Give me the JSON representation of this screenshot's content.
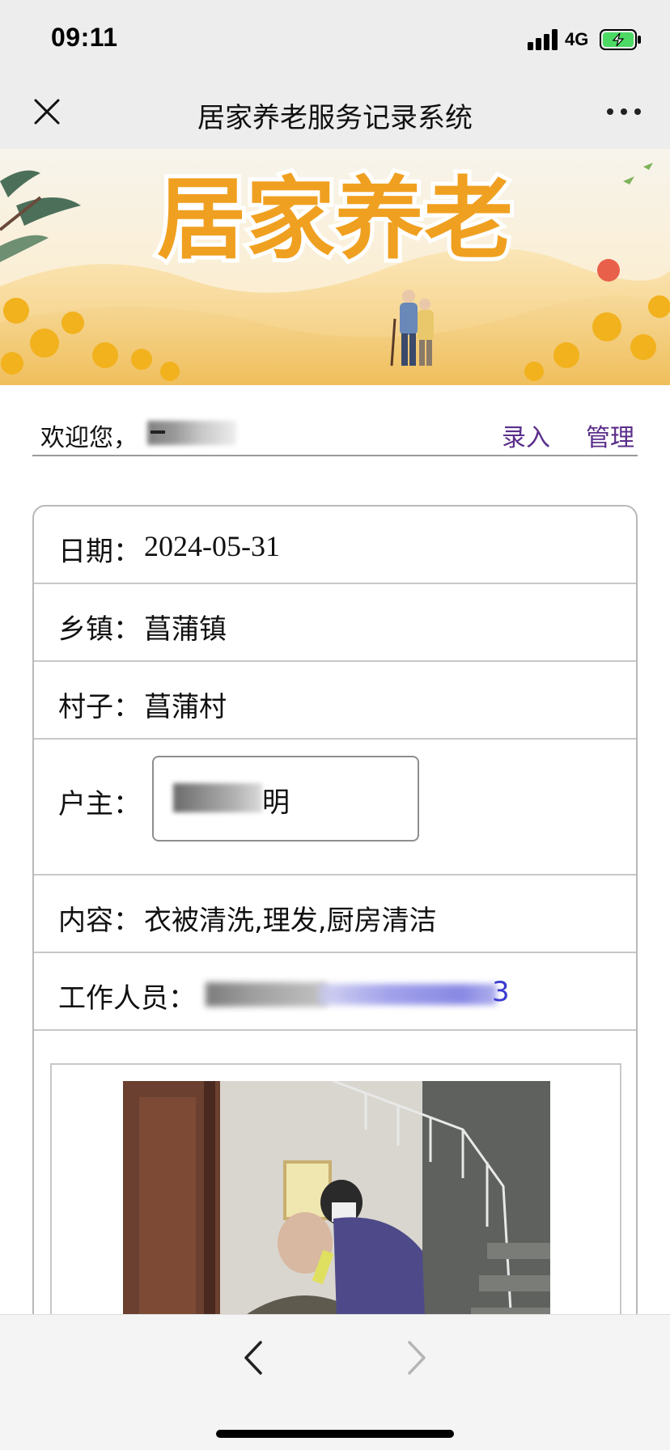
{
  "status_bar": {
    "time": "09:11",
    "network": "4G"
  },
  "nav_bar": {
    "title": "居家养老服务记录系统"
  },
  "banner": {
    "title": "居家养老"
  },
  "welcome": {
    "greeting": "欢迎您，",
    "entry_link": "录入",
    "manage_link": "管理"
  },
  "record": {
    "date_label": "日期：",
    "date_value": "2024-05-31",
    "town_label": "乡镇：",
    "town_value": "菖蒲镇",
    "village_label": "村子：",
    "village_value": "菖蒲村",
    "owner_label": "户主：",
    "owner_value_tail": "明",
    "content_label": "内容：",
    "content_value": "衣被清洗,理发,厨房清洁",
    "staff_label": "工作人员：",
    "staff_value_tail": "3"
  },
  "colors": {
    "link": "#5a2e8a",
    "chrome": "#ededed",
    "border": "#c8c8c8"
  }
}
